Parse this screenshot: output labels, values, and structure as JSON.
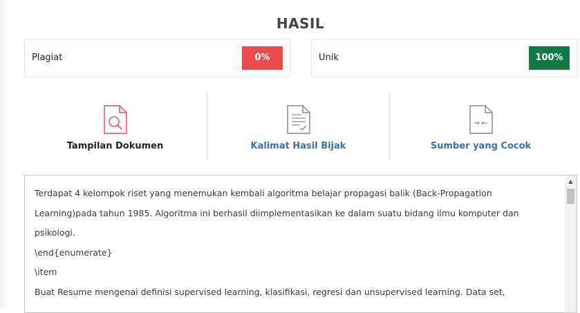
{
  "result": {
    "title": "HASIL",
    "plagiat": {
      "label": "Plagiat",
      "value": "0%",
      "color": "#e84c4f"
    },
    "unik": {
      "label": "Unik",
      "value": "100%",
      "color": "#147a45"
    }
  },
  "tools": [
    {
      "label": "Tampilan Dokumen",
      "icon": "document-search-icon"
    },
    {
      "label": "Kalimat Hasil Bijak",
      "icon": "document-check-icon"
    },
    {
      "label": "Sumber yang Cocok",
      "icon": "document-compare-icon"
    }
  ],
  "document_text": {
    "lines": [
      "Terdapat 4 kelompok riset yang menemukan kembali algoritma belajar propagasi balik (Back-Propagation",
      "Learning)pada tahun 1985. Algoritma ini berhasil diimplementasikan ke dalam suatu bidang ilmu komputer dan",
      "psikologi.",
      "\\end{enumerate}",
      "\\item",
      "Buat Resume mengenai definisi supervised learning, klasifikasi, regresi dan unsupervised learning. Data set,"
    ]
  }
}
